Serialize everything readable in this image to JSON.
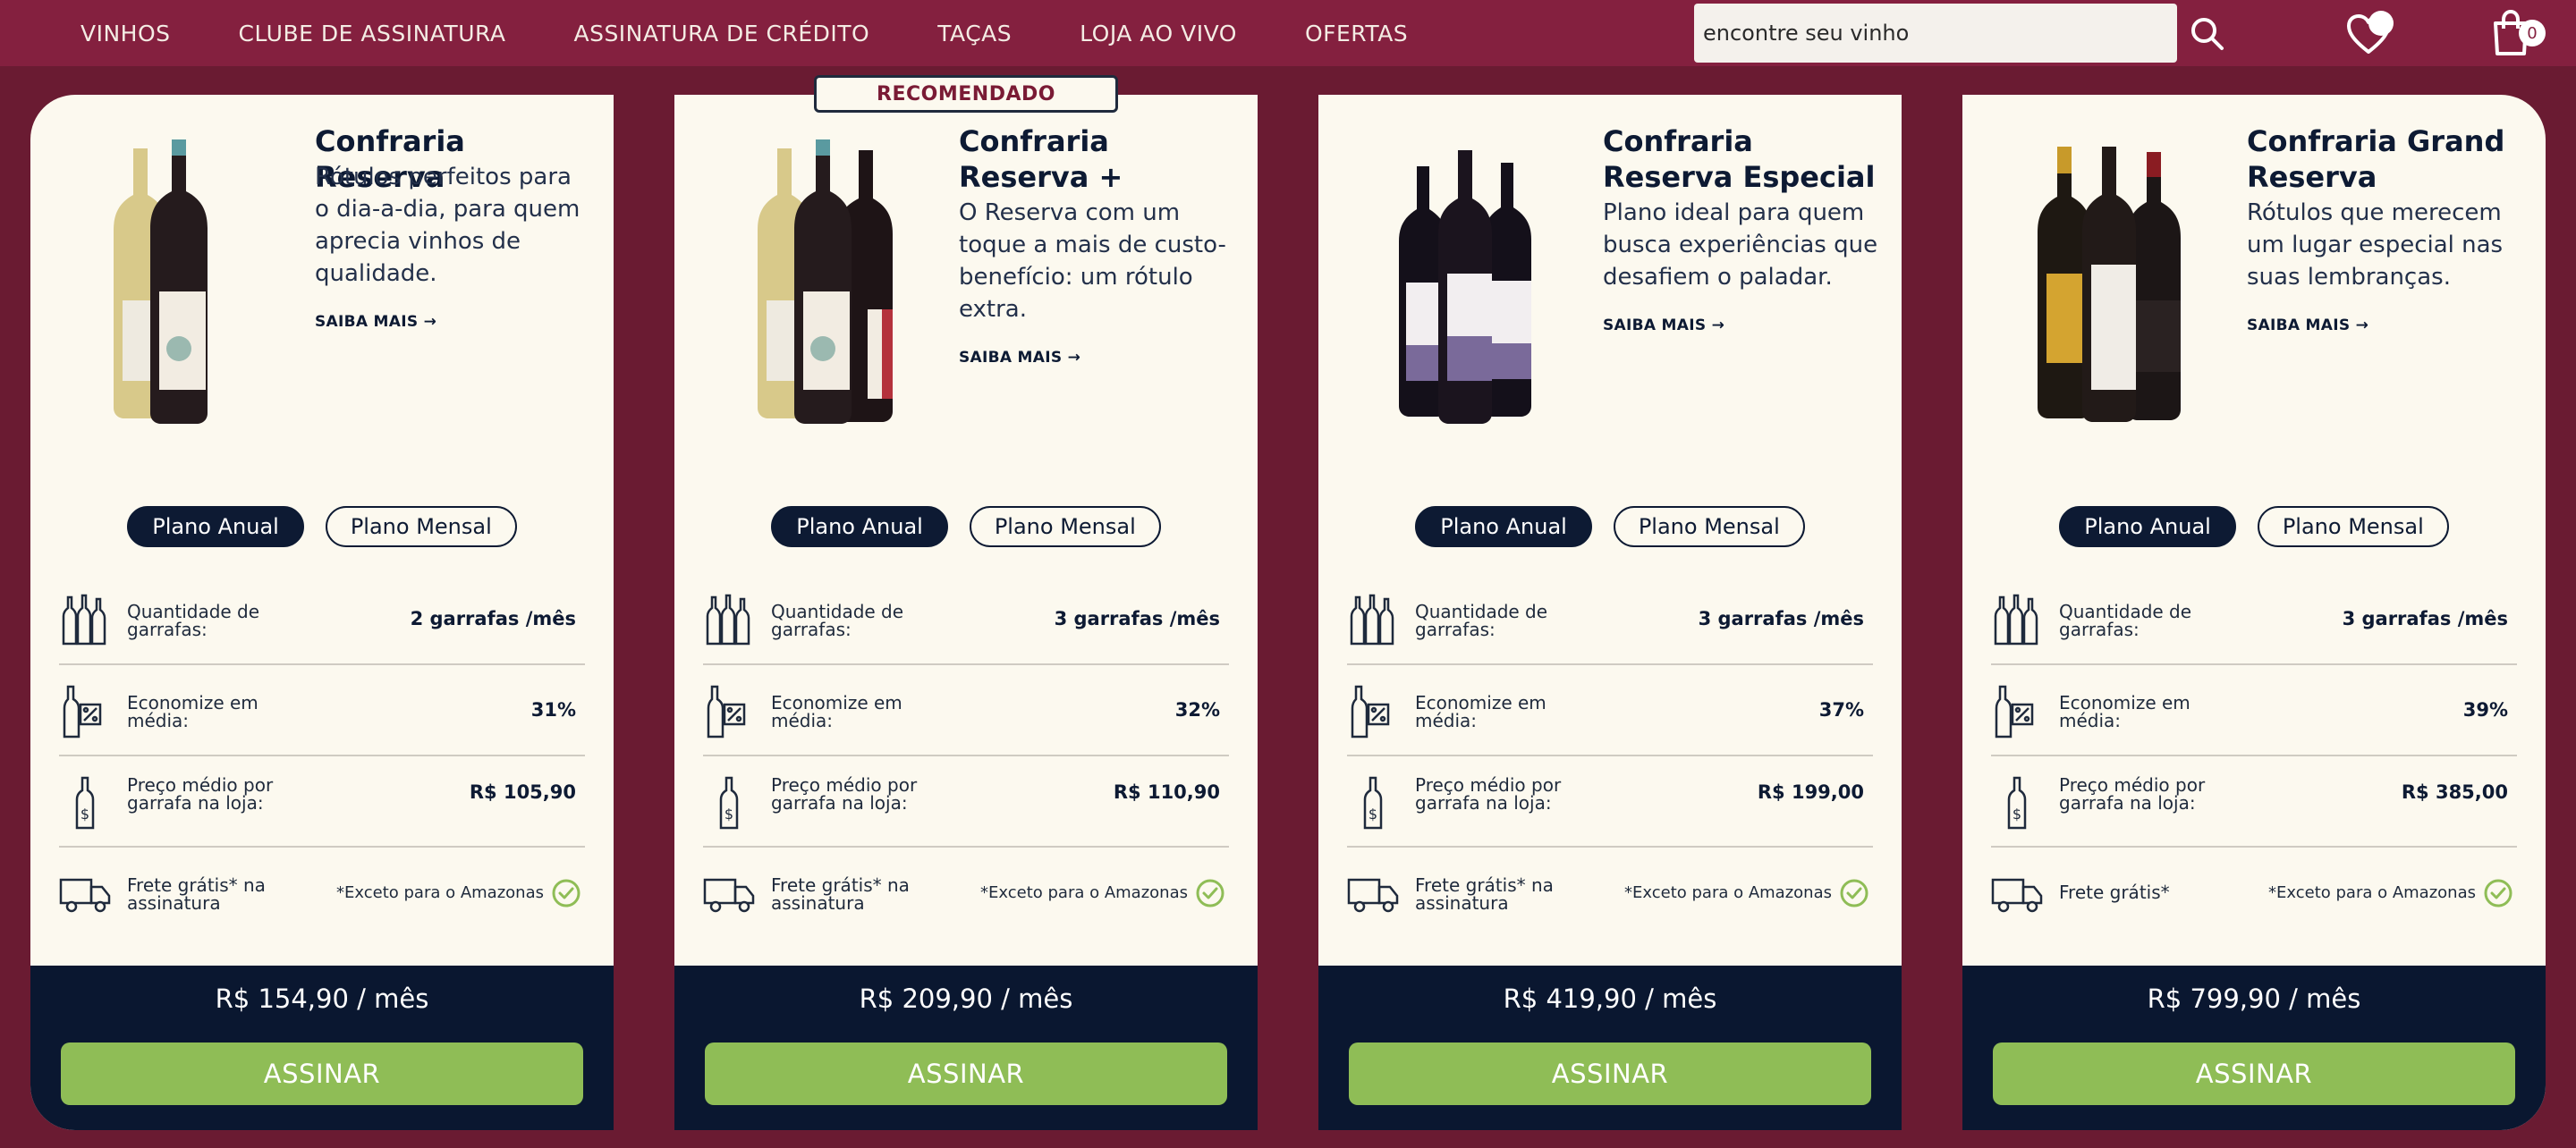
{
  "nav": {
    "links": [
      "VINHOS",
      "CLUBE DE ASSINATURA",
      "ASSINATURA DE CRÉDITO",
      "TAÇAS",
      "LOJA AO VIVO",
      "OFERTAS"
    ],
    "search_placeholder": "encontre seu vinho",
    "cart_count": "0",
    "icons": {
      "search": "search-icon",
      "wishlist": "heart-icon",
      "cart": "shopping-bag-icon"
    }
  },
  "badge": "RECOMENDADO",
  "colors": {
    "nav_bg": "#84203f",
    "page_bg": "#6a1b32",
    "card_bg": "#fcf9ef",
    "navy": "#0a1730",
    "green": "#8fbd56"
  },
  "plans": [
    {
      "title": "Confraria Reserva",
      "description": "Rótulos perfeitos para o dia-a-dia, para quem aprecia vinhos de qualidade.",
      "saiba": "SAIBA MAIS",
      "plan_anual": "Plano Anual",
      "plan_mensal": "Plano Mensal",
      "qty_label": "Quantidade de garrafas:",
      "qty_value": "2 garrafas /mês",
      "save_label": "Economize em média:",
      "save_value": "31%",
      "avg_label": "Preço médio por garrafa na loja:",
      "avg_value": "R$ 105,90",
      "ship_label": "Frete grátis* na assinatura",
      "ship_note": "*Exceto para o Amazonas",
      "price": "R$ 154,90 / mês",
      "cta": "ASSINAR"
    },
    {
      "title": "Confraria Reserva +",
      "description": "O Reserva com um toque a mais de custo-benefício: um rótulo extra.",
      "saiba": "SAIBA MAIS",
      "plan_anual": "Plano Anual",
      "plan_mensal": "Plano Mensal",
      "qty_label": "Quantidade de garrafas:",
      "qty_value": "3 garrafas /mês",
      "save_label": "Economize em média:",
      "save_value": "32%",
      "avg_label": "Preço médio por garrafa na loja:",
      "avg_value": "R$ 110,90",
      "ship_label": "Frete grátis* na assinatura",
      "ship_note": "*Exceto para o Amazonas",
      "price": "R$ 209,90 / mês",
      "cta": "ASSINAR"
    },
    {
      "title": "Confraria Reserva Especial",
      "description": "Plano ideal para quem busca experiências que desafiem o paladar.",
      "saiba": "SAIBA MAIS",
      "plan_anual": "Plano Anual",
      "plan_mensal": "Plano Mensal",
      "qty_label": "Quantidade de garrafas:",
      "qty_value": "3 garrafas /mês",
      "save_label": "Economize em média:",
      "save_value": "37%",
      "avg_label": "Preço médio por garrafa na loja:",
      "avg_value": "R$ 199,00",
      "ship_label": "Frete grátis* na assinatura",
      "ship_note": "*Exceto para o Amazonas",
      "price": "R$ 419,90 / mês",
      "cta": "ASSINAR"
    },
    {
      "title": "Confraria Grand Reserva",
      "description": "Rótulos que merecem um lugar especial nas suas lembranças.",
      "saiba": "SAIBA MAIS",
      "plan_anual": "Plano Anual",
      "plan_mensal": "Plano Mensal",
      "qty_label": "Quantidade de garrafas:",
      "qty_value": "3 garrafas /mês",
      "save_label": "Economize em média:",
      "save_value": "39%",
      "avg_label": "Preço médio por garrafa na loja:",
      "avg_value": "R$ 385,00",
      "ship_label": "Frete grátis*",
      "ship_note": "*Exceto para o Amazonas",
      "price": "R$ 799,90 / mês",
      "cta": "ASSINAR"
    }
  ]
}
